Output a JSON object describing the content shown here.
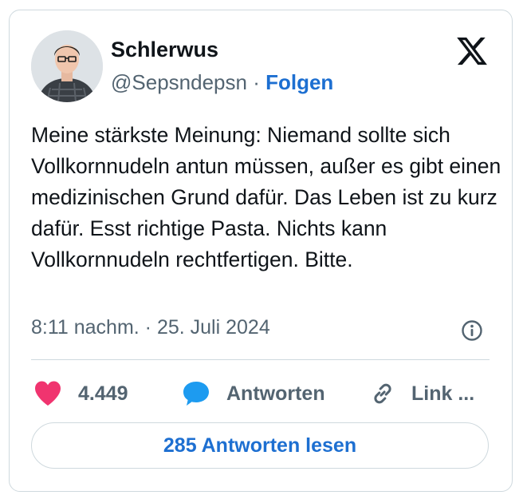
{
  "author": {
    "name": "Schlerwus",
    "handle": "@Sepsndepsn",
    "separator": " · ",
    "follow_label": "Folgen"
  },
  "brand_icon": "x-logo-icon",
  "tweet": {
    "text": "Meine stärkste Meinung: Niemand sollte sich Vollkornnudeln antun müssen, außer es gibt einen medizinischen Grund dafür. Das Leben ist zu kurz dafür. Esst richtige Pasta. Nichts kann Vollkornnudeln rechtfertigen. Bitte.",
    "timestamp": "8:11 nachm. · 25. Juli 2024"
  },
  "actions": {
    "likes": "4.449",
    "reply_label": "Antworten",
    "link_label": "Link ..."
  },
  "read_replies_label": "285 Antworten lesen",
  "colors": {
    "accent": "#1d6fd1",
    "heart": "#f0346f",
    "reply_bubble": "#1d9bf0",
    "muted": "#536471",
    "border": "#cfd9de"
  }
}
